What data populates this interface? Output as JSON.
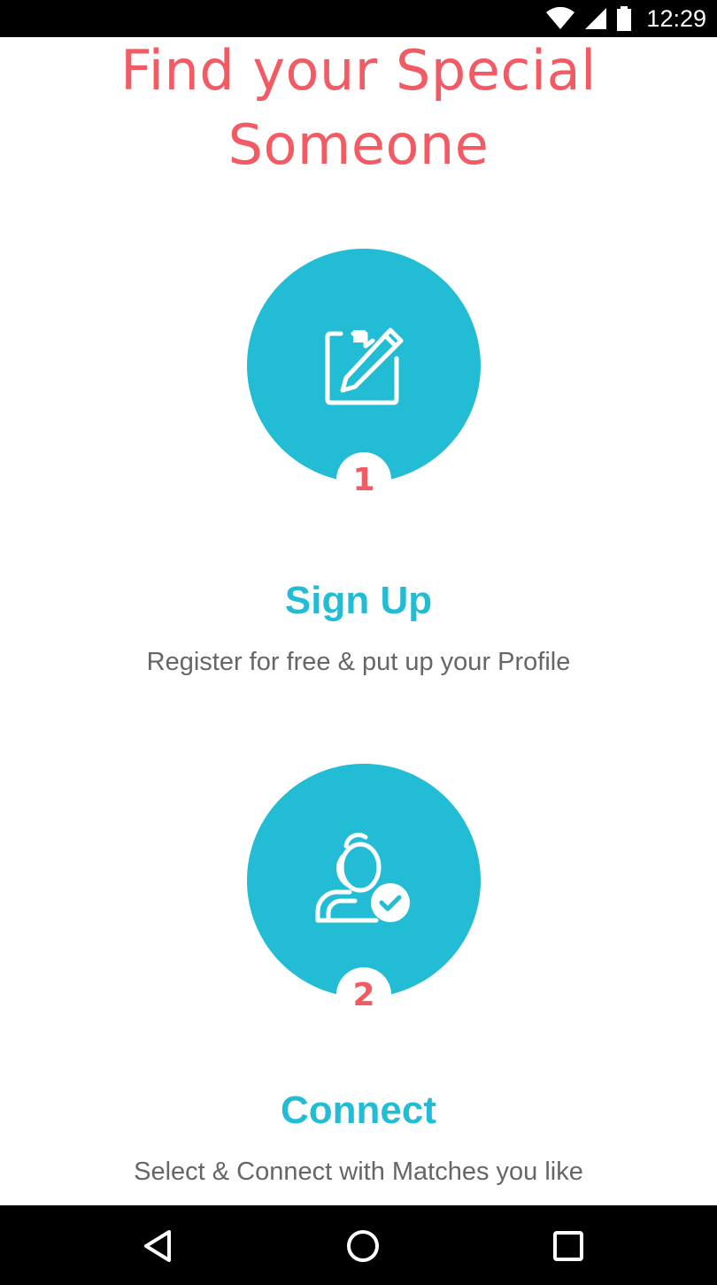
{
  "status_bar": {
    "time": "12:29",
    "icons": [
      "wifi-icon",
      "signal-icon",
      "battery-icon"
    ]
  },
  "headline": {
    "line1": "Find your Special",
    "line2": "Someone"
  },
  "colors": {
    "accent": "#22bcd5",
    "headline": "#f25a64",
    "body_text": "#666666"
  },
  "steps": [
    {
      "number": "1",
      "title": "Sign Up",
      "description": "Register for free & put up your Profile",
      "icon": "edit-form-icon"
    },
    {
      "number": "2",
      "title": "Connect",
      "description": "Select & Connect with Matches you like",
      "icon": "user-check-icon"
    }
  ],
  "nav_bar": {
    "buttons": [
      "back-icon",
      "home-icon",
      "recents-icon"
    ]
  }
}
